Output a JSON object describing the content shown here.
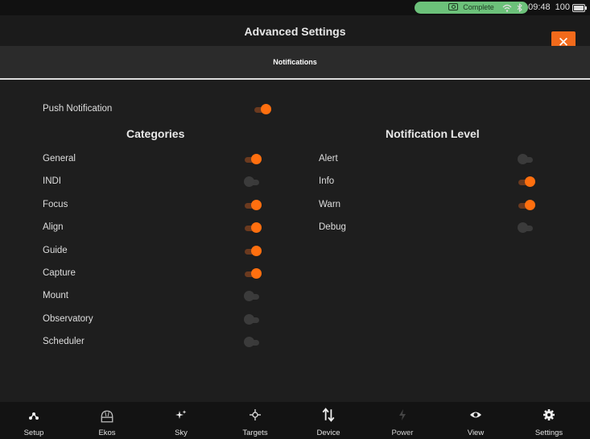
{
  "statusbar": {
    "pill_text": "Complete",
    "time": "09:48",
    "battery": "100"
  },
  "header": {
    "title": "Advanced Settings",
    "close_symbol": "✕"
  },
  "tab": {
    "label": "Notifications"
  },
  "push": {
    "label": "Push Notification",
    "on": true
  },
  "categories": {
    "heading": "Categories",
    "items": [
      {
        "label": "General",
        "on": true
      },
      {
        "label": "INDI",
        "on": false
      },
      {
        "label": "Focus",
        "on": true
      },
      {
        "label": "Align",
        "on": true
      },
      {
        "label": "Guide",
        "on": true
      },
      {
        "label": "Capture",
        "on": true
      },
      {
        "label": "Mount",
        "on": false
      },
      {
        "label": "Observatory",
        "on": false
      },
      {
        "label": "Scheduler",
        "on": false
      }
    ]
  },
  "levels": {
    "heading": "Notification Level",
    "items": [
      {
        "label": "Alert",
        "on": false
      },
      {
        "label": "Info",
        "on": true
      },
      {
        "label": "Warn",
        "on": true
      },
      {
        "label": "Debug",
        "on": false
      }
    ]
  },
  "nav": {
    "items": [
      {
        "label": "Setup",
        "icon": "setup-icon"
      },
      {
        "label": "Ekos",
        "icon": "ekos-icon"
      },
      {
        "label": "Sky",
        "icon": "sky-icon"
      },
      {
        "label": "Targets",
        "icon": "targets-icon"
      },
      {
        "label": "Device",
        "icon": "device-icon"
      },
      {
        "label": "Power",
        "icon": "power-icon"
      },
      {
        "label": "View",
        "icon": "view-icon"
      },
      {
        "label": "Settings",
        "icon": "settings-icon"
      }
    ]
  },
  "colors": {
    "accent": "#ff6f0f",
    "pill": "#6cc17a",
    "background": "#1e1e1e"
  }
}
